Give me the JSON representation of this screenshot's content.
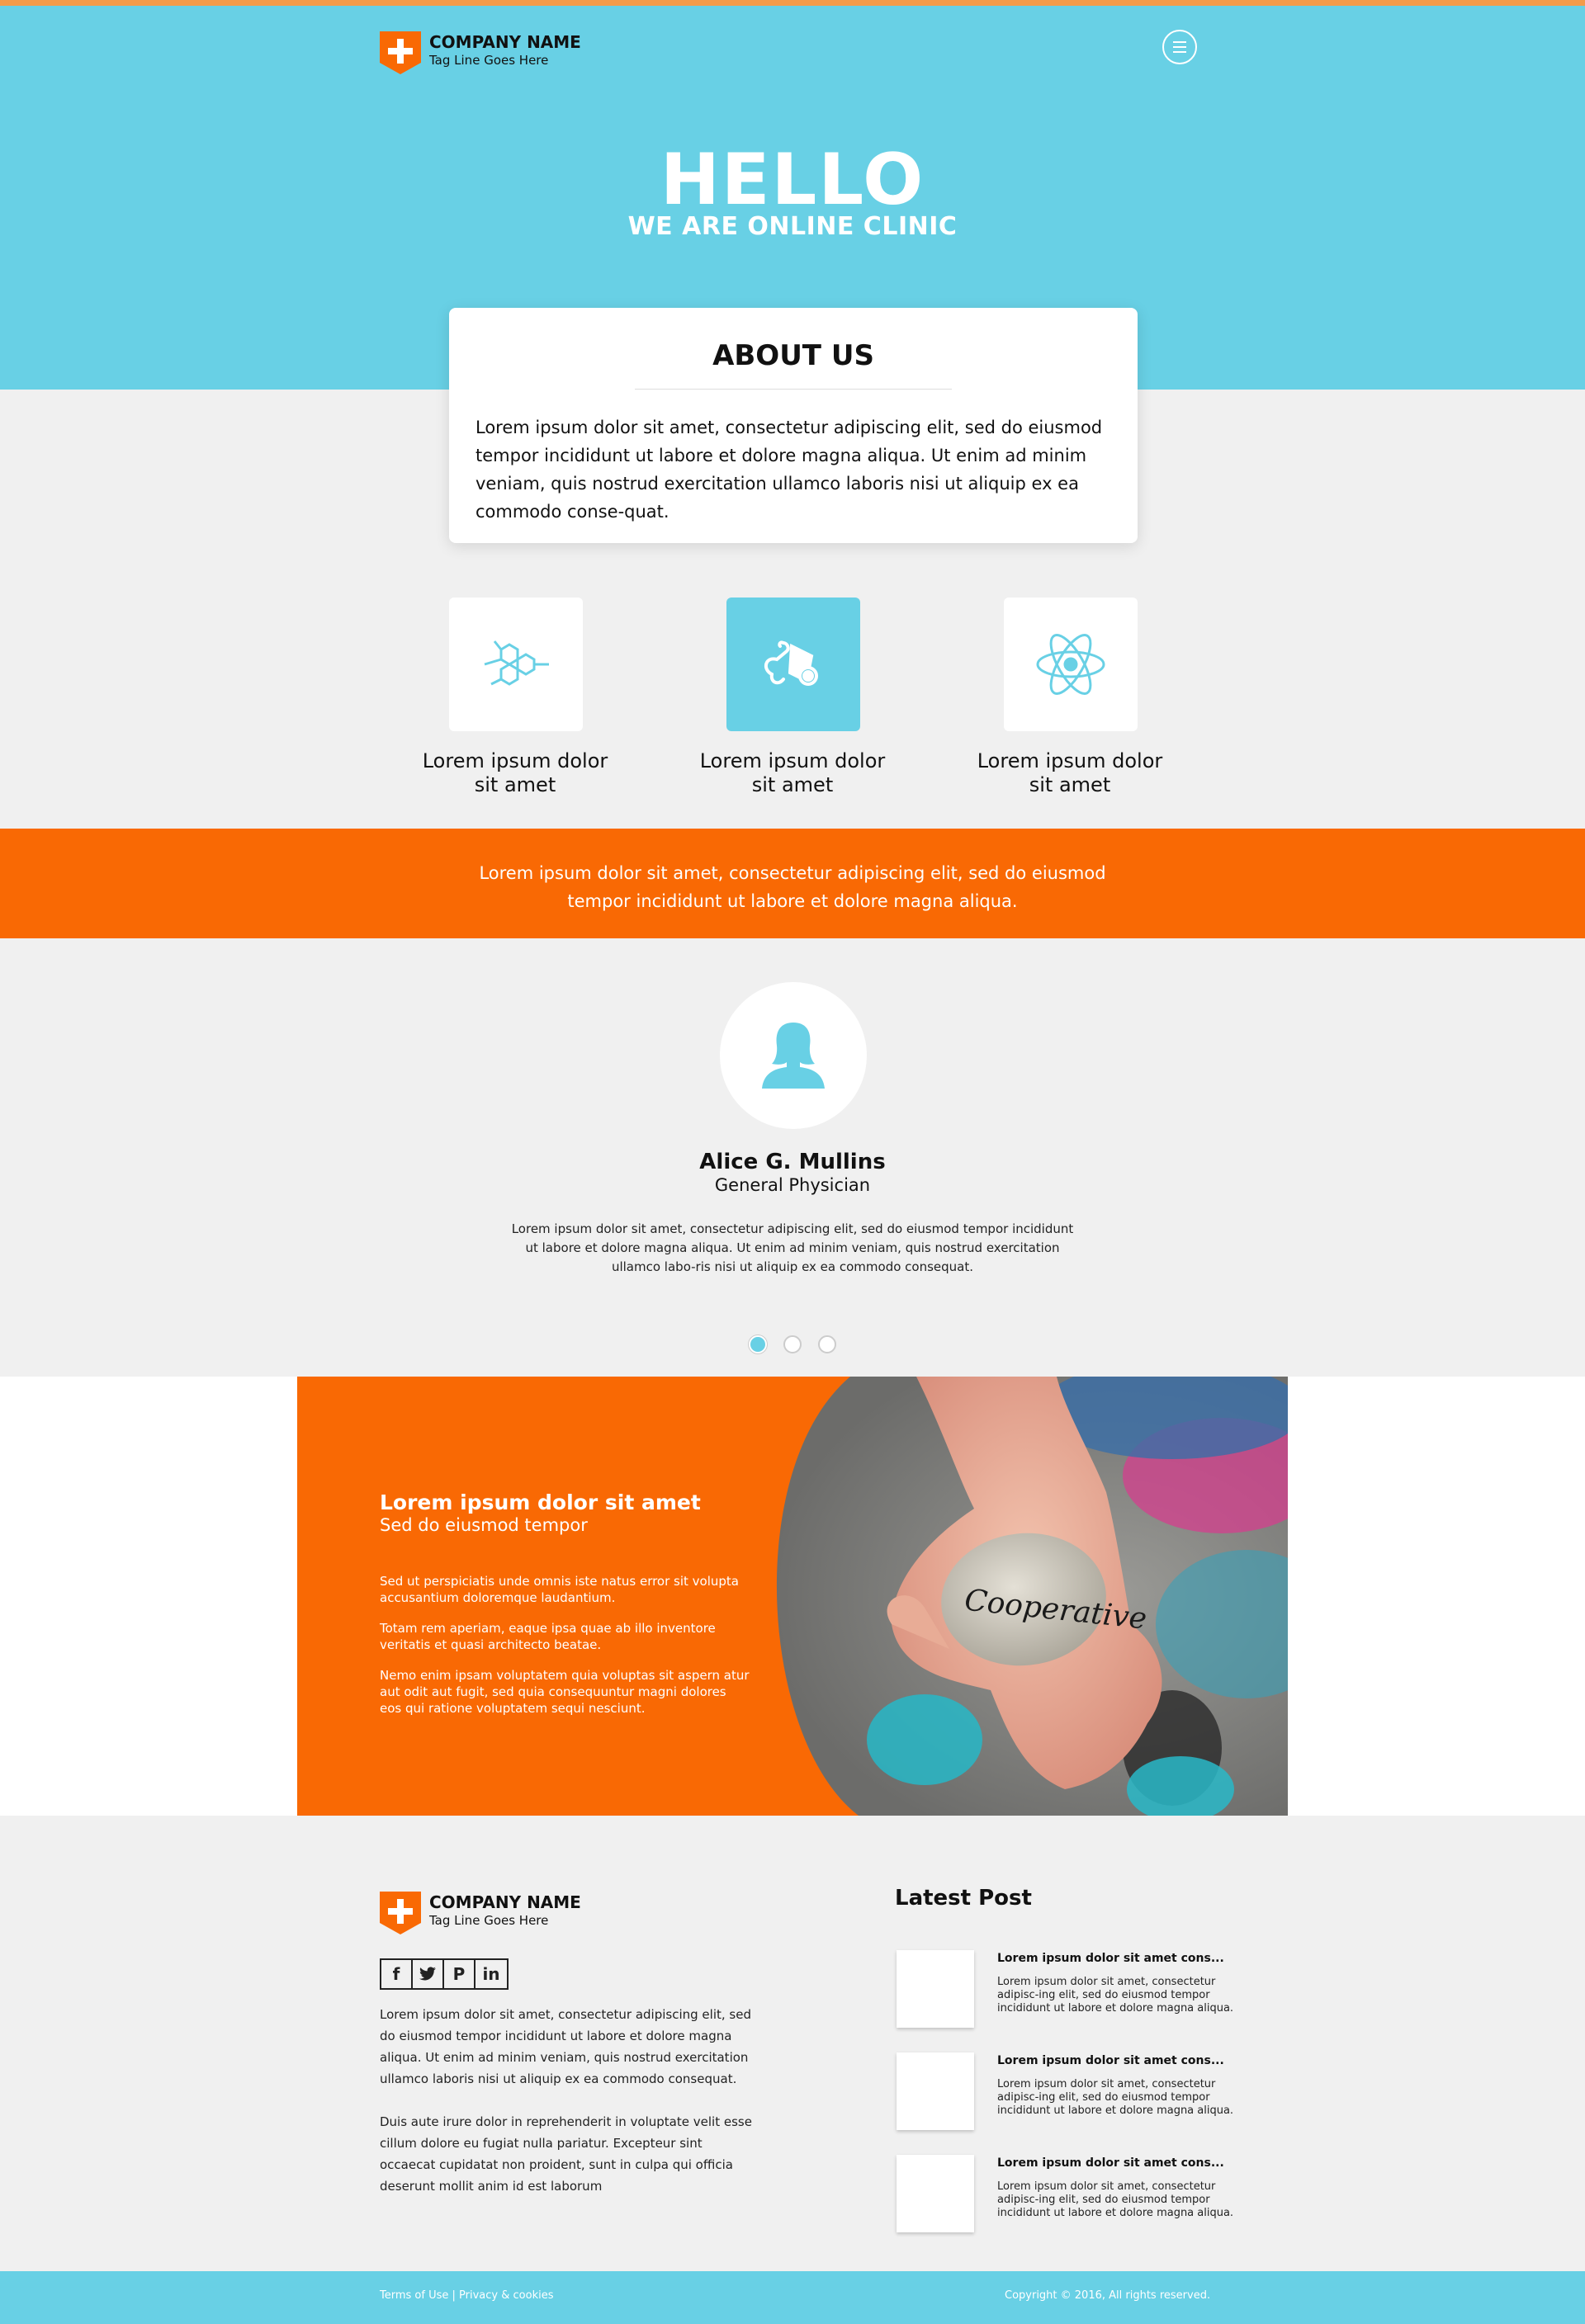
{
  "header": {
    "company_name": "COMPANY NAME",
    "tagline": "Tag Line Goes Here",
    "menu_icon": "hamburger-menu-icon"
  },
  "hero": {
    "title": "HELLO",
    "subtitle": "WE ARE ONLINE CLINIC"
  },
  "about": {
    "heading": "ABOUT US",
    "text": "Lorem ipsum dolor sit amet, consectetur adipiscing elit, sed do eiusmod tempor incididunt ut labore et dolore magna aliqua. Ut enim ad minim veniam, quis nostrud exercitation ullamco laboris nisi ut aliquip ex ea commodo conse-quat."
  },
  "features": [
    {
      "icon": "molecule-icon",
      "line1": "Lorem ipsum dolor",
      "line2": "sit amet"
    },
    {
      "icon": "stethoscope-icon",
      "line1": "Lorem ipsum dolor",
      "line2": "sit amet"
    },
    {
      "icon": "atom-icon",
      "line1": "Lorem ipsum dolor",
      "line2": "sit amet"
    }
  ],
  "banner": {
    "line1": "Lorem ipsum dolor sit amet, consectetur adipiscing elit, sed do eiusmod",
    "line2": "tempor incididunt ut labore et dolore magna aliqua."
  },
  "testimonial": {
    "avatar_icon": "female-user-icon",
    "name": "Alice G. Mullins",
    "role": "General Physician",
    "text": "Lorem ipsum dolor sit amet, consectetur adipiscing elit, sed do eiusmod tempor incididunt ut labore et dolore magna aliqua. Ut enim ad minim veniam, quis nostrud exercitation ullamco labo-ris nisi ut aliquip ex ea commodo consequat.",
    "active_slide": 1,
    "slide_count": 3
  },
  "promo": {
    "title": "Lorem ipsum dolor sit amet",
    "subtitle": "Sed do eiusmod tempor",
    "para1": "Sed ut perspiciatis unde omnis iste natus error sit volupta accusantium doloremque laudantium.",
    "para2": "Totam rem aperiam, eaque ipsa quae ab illo inventore veritatis et quasi architecto beatae.",
    "para3": "Nemo enim ipsam voluptatem quia voluptas sit aspern atur aut odit aut fugit, sed quia consequuntur magni dolores eos qui ratione voluptatem sequi nesciunt.",
    "stone_text": "Cooperative"
  },
  "footer": {
    "company_name": "COMPANY NAME",
    "tagline": "Tag Line Goes Here",
    "social": [
      {
        "icon": "facebook-icon",
        "glyph": "f"
      },
      {
        "icon": "twitter-icon",
        "glyph": "🐦"
      },
      {
        "icon": "pinterest-icon",
        "glyph": "P"
      },
      {
        "icon": "linkedin-icon",
        "glyph": "in"
      }
    ],
    "about_p1": "Lorem ipsum dolor sit amet, consectetur adipiscing elit, sed do eiusmod tempor incididunt ut labore et dolore magna aliqua. Ut enim ad minim veniam, quis nostrud exercitation ullamco laboris nisi ut aliquip ex ea commodo consequat.",
    "about_p2": "Duis aute irure dolor in reprehenderit in voluptate velit esse cillum dolore eu fugiat nulla pariatur. Excepteur sint occaecat cupidatat non proident, sunt in culpa qui officia deserunt mollit anim id est laborum",
    "latest_title": "Latest Post",
    "posts": [
      {
        "title": "Lorem ipsum dolor sit amet cons...",
        "body": "Lorem ipsum dolor sit amet, consectetur adipisc-ing elit, sed do eiusmod tempor incididunt ut labore et dolore magna aliqua."
      },
      {
        "title": "Lorem ipsum dolor sit amet cons...",
        "body": "Lorem ipsum dolor sit amet, consectetur adipisc-ing elit, sed do eiusmod tempor incididunt ut labore et dolore magna aliqua."
      },
      {
        "title": "Lorem ipsum dolor sit amet cons...",
        "body": "Lorem ipsum dolor sit amet, consectetur adipisc-ing elit, sed do eiusmod tempor incididunt ut labore et dolore magna aliqua."
      }
    ]
  },
  "bottom_bar": {
    "terms": "Terms of Use",
    "separator": "|",
    "privacy": "Privacy & cookies",
    "copyright": "Copyright © 2016, All rights reserved."
  },
  "colors": {
    "accent_blue": "#68d0e5",
    "accent_orange": "#f96904",
    "background": "#f0f0f0"
  }
}
